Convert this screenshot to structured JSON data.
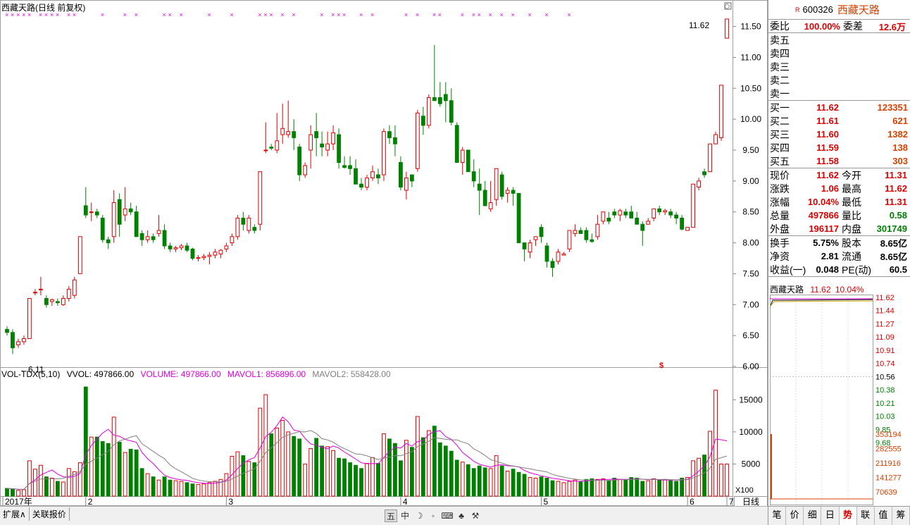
{
  "chart": {
    "title": "西藏天路(日线 前复权)",
    "high_label": "11.62",
    "low_label": "6.11",
    "price_ticks": [
      "11.50",
      "11.00",
      "10.50",
      "10.00",
      "9.50",
      "9.00",
      "8.50",
      "8.00",
      "7.50",
      "7.00",
      "6.50",
      "6.00"
    ],
    "vol_ticks": [
      "15000",
      "10000",
      "5000"
    ],
    "vol_unit": "X100",
    "date_labels": [
      "2017年",
      "2",
      "3",
      "4",
      "5",
      "6",
      "7"
    ],
    "period": "日线"
  },
  "volume_header": {
    "name": "VOL-TDX(5,10)",
    "vvol": "VVOL: 497866.00",
    "volume": "VOLUME: 497866.00",
    "mavol1": "MAVOL1: 856896.00",
    "mavol2": "MAVOL2: 558428.00"
  },
  "bottom_tabs": [
    "扩展∧",
    "关联报价"
  ],
  "toolbar": [
    "五",
    "中",
    "☽",
    "◦",
    "⌨",
    "♣",
    "⚒"
  ],
  "stock": {
    "code": "600326",
    "name": "西藏天路",
    "mark": "R"
  },
  "quote": {
    "weibi_label": "委比",
    "weibi": "100.00%",
    "weicha_label": "委差",
    "weicha": "12.6万",
    "sell": [
      {
        "label": "卖五",
        "price": "",
        "vol": ""
      },
      {
        "label": "卖四",
        "price": "",
        "vol": ""
      },
      {
        "label": "卖三",
        "price": "",
        "vol": ""
      },
      {
        "label": "卖二",
        "price": "",
        "vol": ""
      },
      {
        "label": "卖一",
        "price": "",
        "vol": ""
      }
    ],
    "buy": [
      {
        "label": "买一",
        "price": "11.62",
        "vol": "123351"
      },
      {
        "label": "买二",
        "price": "11.61",
        "vol": "621"
      },
      {
        "label": "买三",
        "price": "11.60",
        "vol": "1382"
      },
      {
        "label": "买四",
        "price": "11.59",
        "vol": "138"
      },
      {
        "label": "买五",
        "price": "11.58",
        "vol": "303"
      }
    ],
    "stats": [
      {
        "l1": "现价",
        "v1": "11.62",
        "l2": "今开",
        "v2": "11.31",
        "c1": "red",
        "c2": "red"
      },
      {
        "l1": "涨跌",
        "v1": "1.06",
        "l2": "最高",
        "v2": "11.62",
        "c1": "red",
        "c2": "red"
      },
      {
        "l1": "涨幅",
        "v1": "10.04%",
        "l2": "最低",
        "v2": "11.31",
        "c1": "red",
        "c2": "red"
      },
      {
        "l1": "总量",
        "v1": "497866",
        "l2": "量比",
        "v2": "0.58",
        "c1": "red",
        "c2": "green"
      },
      {
        "l1": "外盘",
        "v1": "196117",
        "l2": "内盘",
        "v2": "301749",
        "c1": "red",
        "c2": "green"
      }
    ],
    "fundamentals": [
      {
        "l1": "换手",
        "v1": "5.75%",
        "l2": "股本",
        "v2": "8.65亿"
      },
      {
        "l1": "净资",
        "v1": "2.81",
        "l2": "流通",
        "v2": "8.65亿"
      },
      {
        "l1": "收益(一)",
        "v1": "0.048",
        "l2": "PE(动)",
        "v2": "60.5"
      }
    ]
  },
  "mini": {
    "name": "西藏天路",
    "price": "11.62",
    "pct": "10.04%",
    "price_ticks": [
      "11.62",
      "11.44",
      "11.27",
      "11.09",
      "10.91",
      "10.74",
      "10.56",
      "10.38",
      "10.21",
      "10.03",
      "9.85",
      "9.68"
    ],
    "vol_ticks": [
      "353194",
      "282555",
      "211916",
      "141277",
      "70639"
    ]
  },
  "right_tabs": [
    "笔",
    "价",
    "细",
    "日",
    "势",
    "联",
    "值",
    "筹"
  ],
  "right_active": "势",
  "colors": {
    "up": "#e00000",
    "down": "#008000",
    "ma1": "#e000e0",
    "ma2": "#808080"
  },
  "chart_data": {
    "type": "candlestick",
    "ylim": [
      6.0,
      11.62
    ],
    "candles": [
      [
        6.6,
        6.65,
        6.5,
        6.55
      ],
      [
        6.55,
        6.6,
        6.2,
        6.3
      ],
      [
        6.35,
        6.45,
        6.3,
        6.4
      ],
      [
        6.4,
        6.5,
        6.35,
        6.45
      ],
      [
        6.45,
        7.1,
        6.45,
        7.1
      ],
      [
        7.2,
        7.25,
        7.15,
        7.2
      ],
      [
        7.25,
        7.45,
        7.15,
        7.25
      ],
      [
        7.1,
        7.15,
        6.95,
        7.0
      ],
      [
        7.05,
        7.1,
        6.98,
        7.08
      ],
      [
        7.05,
        7.1,
        6.98,
        7.03
      ],
      [
        7.0,
        7.15,
        6.98,
        7.1
      ],
      [
        7.1,
        7.3,
        7.05,
        7.25
      ],
      [
        7.15,
        7.45,
        7.1,
        7.4
      ],
      [
        7.5,
        8.1,
        7.5,
        8.1
      ],
      [
        8.6,
        8.9,
        8.4,
        8.45
      ],
      [
        8.5,
        8.65,
        8.35,
        8.5
      ],
      [
        8.5,
        8.55,
        8.4,
        8.45
      ],
      [
        8.4,
        8.45,
        8.0,
        8.05
      ],
      [
        8.05,
        8.1,
        7.9,
        8.0
      ],
      [
        8.1,
        8.85,
        8.0,
        8.65
      ],
      [
        8.7,
        8.8,
        8.1,
        8.3
      ],
      [
        8.45,
        8.9,
        8.35,
        8.55
      ],
      [
        8.55,
        8.65,
        8.45,
        8.5
      ],
      [
        8.5,
        8.6,
        8.1,
        8.1
      ],
      [
        8.15,
        8.2,
        7.95,
        8.05
      ],
      [
        8.05,
        8.2,
        8.0,
        8.1
      ],
      [
        8.1,
        8.15,
        8.0,
        8.05
      ],
      [
        8.15,
        8.45,
        8.1,
        8.2
      ],
      [
        8.2,
        8.3,
        7.9,
        7.95
      ],
      [
        7.95,
        8.0,
        7.85,
        7.9
      ],
      [
        7.9,
        7.95,
        7.85,
        7.92
      ],
      [
        7.92,
        7.98,
        7.88,
        7.95
      ],
      [
        7.95,
        8.0,
        7.85,
        7.88
      ],
      [
        7.9,
        7.92,
        7.72,
        7.75
      ],
      [
        7.75,
        7.8,
        7.7,
        7.76
      ],
      [
        7.76,
        7.82,
        7.72,
        7.78
      ],
      [
        7.78,
        7.85,
        7.65,
        7.8
      ],
      [
        7.8,
        7.9,
        7.75,
        7.85
      ],
      [
        7.82,
        7.9,
        7.75,
        7.88
      ],
      [
        7.9,
        8.0,
        7.85,
        7.95
      ],
      [
        8.0,
        8.15,
        7.95,
        8.1
      ],
      [
        8.1,
        8.45,
        8.05,
        8.4
      ],
      [
        8.4,
        8.5,
        8.2,
        8.3
      ],
      [
        8.2,
        8.45,
        8.15,
        8.4
      ],
      [
        8.25,
        8.3,
        8.15,
        8.2
      ],
      [
        8.3,
        9.1,
        8.2,
        9.15
      ],
      [
        9.5,
        9.95,
        9.45,
        9.5
      ],
      [
        9.55,
        9.6,
        9.5,
        9.53
      ],
      [
        9.5,
        10.1,
        9.45,
        9.65
      ],
      [
        9.75,
        10.25,
        9.6,
        9.85
      ],
      [
        9.75,
        10.3,
        9.7,
        9.8
      ],
      [
        9.8,
        10.0,
        9.5,
        9.7
      ],
      [
        9.55,
        9.6,
        9.0,
        9.1
      ],
      [
        9.1,
        9.3,
        9.05,
        9.25
      ],
      [
        9.5,
        9.9,
        9.2,
        9.75
      ],
      [
        9.8,
        10.1,
        9.4,
        9.7
      ],
      [
        9.6,
        9.8,
        9.4,
        9.55
      ],
      [
        9.5,
        9.8,
        9.4,
        9.6
      ],
      [
        9.6,
        9.9,
        9.5,
        9.78
      ],
      [
        9.75,
        9.85,
        9.2,
        9.3
      ],
      [
        9.25,
        9.4,
        9.2,
        9.22
      ],
      [
        9.25,
        9.4,
        9.1,
        9.2
      ],
      [
        9.2,
        9.35,
        9.05,
        8.95
      ],
      [
        8.95,
        9.05,
        8.85,
        8.9
      ],
      [
        8.9,
        9.1,
        8.85,
        9.05
      ],
      [
        9.05,
        9.25,
        9.0,
        9.15
      ],
      [
        9.1,
        9.2,
        8.95,
        9.05
      ],
      [
        9.1,
        9.85,
        9.0,
        9.8
      ],
      [
        9.8,
        9.9,
        9.6,
        9.7
      ],
      [
        9.7,
        9.9,
        9.4,
        9.6
      ],
      [
        9.3,
        9.4,
        8.85,
        8.9
      ],
      [
        8.85,
        9.15,
        8.7,
        9.05
      ],
      [
        9.1,
        9.1,
        8.9,
        9.0
      ],
      [
        9.2,
        10.15,
        9.15,
        10.1
      ],
      [
        10.05,
        10.2,
        9.75,
        9.9
      ],
      [
        9.9,
        10.4,
        9.85,
        10.35
      ],
      [
        10.35,
        11.2,
        10.3,
        10.3
      ],
      [
        10.35,
        10.6,
        10.2,
        10.25
      ],
      [
        10.4,
        10.6,
        9.95,
        10.3
      ],
      [
        10.3,
        10.5,
        9.9,
        9.95
      ],
      [
        9.9,
        9.95,
        9.3,
        9.3
      ],
      [
        9.3,
        9.55,
        9.1,
        9.5
      ],
      [
        9.5,
        9.5,
        9.15,
        9.15
      ],
      [
        9.15,
        9.35,
        8.9,
        9.0
      ],
      [
        8.95,
        9.2,
        8.45,
        8.85
      ],
      [
        8.85,
        9.0,
        8.6,
        8.6
      ],
      [
        8.55,
        9.0,
        8.5,
        8.65
      ],
      [
        8.7,
        9.2,
        8.6,
        9.2
      ],
      [
        9.1,
        9.15,
        8.7,
        8.75
      ],
      [
        8.8,
        8.9,
        8.65,
        8.85
      ],
      [
        8.85,
        8.9,
        8.6,
        8.8
      ],
      [
        8.8,
        8.8,
        8.0,
        8.0
      ],
      [
        8.0,
        8.0,
        7.7,
        7.9
      ],
      [
        7.85,
        8.05,
        7.75,
        8.0
      ],
      [
        8.05,
        8.1,
        7.95,
        8.1
      ],
      [
        8.25,
        8.3,
        8.0,
        8.1
      ],
      [
        7.95,
        8.0,
        7.6,
        7.7
      ],
      [
        7.7,
        7.75,
        7.45,
        7.6
      ],
      [
        7.7,
        7.9,
        7.65,
        7.85
      ],
      [
        7.8,
        7.85,
        7.8,
        7.82
      ],
      [
        7.9,
        8.2,
        7.85,
        8.2
      ],
      [
        8.15,
        8.3,
        8.1,
        8.2
      ],
      [
        8.2,
        8.25,
        8.15,
        8.15
      ],
      [
        8.2,
        8.25,
        8.0,
        8.05
      ],
      [
        8.05,
        8.15,
        8.0,
        8.02
      ],
      [
        8.1,
        8.45,
        8.05,
        8.3
      ],
      [
        8.35,
        8.5,
        8.3,
        8.5
      ],
      [
        8.4,
        8.5,
        8.3,
        8.35
      ],
      [
        8.5,
        8.55,
        8.4,
        8.45
      ],
      [
        8.45,
        8.55,
        8.35,
        8.52
      ],
      [
        8.5,
        8.55,
        8.4,
        8.45
      ],
      [
        8.5,
        8.6,
        8.4,
        8.4
      ],
      [
        8.4,
        8.5,
        8.3,
        8.3
      ],
      [
        8.3,
        8.35,
        7.95,
        8.2
      ],
      [
        8.3,
        8.4,
        8.3,
        8.35
      ],
      [
        8.4,
        8.55,
        8.35,
        8.55
      ],
      [
        8.55,
        8.6,
        8.45,
        8.5
      ],
      [
        8.5,
        8.55,
        8.45,
        8.52
      ],
      [
        8.5,
        8.55,
        8.4,
        8.45
      ],
      [
        8.45,
        8.5,
        8.3,
        8.4
      ],
      [
        8.4,
        8.45,
        8.2,
        8.22
      ],
      [
        8.2,
        8.25,
        8.2,
        8.25
      ],
      [
        8.25,
        8.95,
        8.25,
        8.95
      ],
      [
        8.9,
        9.05,
        8.85,
        9.0
      ],
      [
        9.15,
        9.2,
        9.05,
        9.1
      ],
      [
        9.15,
        9.6,
        9.15,
        9.6
      ],
      [
        9.6,
        9.8,
        9.6,
        9.75
      ],
      [
        9.7,
        10.55,
        9.65,
        10.55
      ],
      [
        11.31,
        11.62,
        11.31,
        11.62
      ]
    ],
    "volumes": [
      1200,
      1100,
      900,
      1000,
      5500,
      4200,
      4800,
      3000,
      2800,
      2300,
      2200,
      4300,
      3800,
      5200,
      17000,
      9200,
      9200,
      8500,
      8200,
      12300,
      8400,
      6800,
      7300,
      7200,
      4300,
      3500,
      3000,
      2500,
      3000,
      2500,
      2400,
      2300,
      2100,
      1900,
      1800,
      1900,
      2100,
      2300,
      2600,
      3500,
      6200,
      6900,
      6300,
      5400,
      5200,
      13700,
      15800,
      9700,
      10600,
      11800,
      10000,
      9300,
      8900,
      5000,
      7400,
      9000,
      7800,
      7700,
      7100,
      5900,
      5800,
      5200,
      4800,
      4300,
      5100,
      6000,
      5100,
      9700,
      8900,
      8200,
      5500,
      8700,
      7600,
      12400,
      9100,
      10200,
      10900,
      8300,
      7800,
      7000,
      5600,
      5300,
      4900,
      4300,
      4700,
      4400,
      4300,
      6300,
      4700,
      3900,
      4200,
      3700,
      3400,
      2900,
      2800,
      3000,
      2800,
      2400,
      2300,
      2100,
      2300,
      2500,
      2300,
      2600,
      2700,
      2600,
      2700,
      2400,
      2800,
      2600,
      2500,
      2900,
      2800,
      2300,
      2400,
      2700,
      2500,
      2600,
      2400,
      2300,
      2800,
      2900,
      5500,
      5900,
      6400,
      10100,
      16500,
      5000,
      5000
    ]
  }
}
